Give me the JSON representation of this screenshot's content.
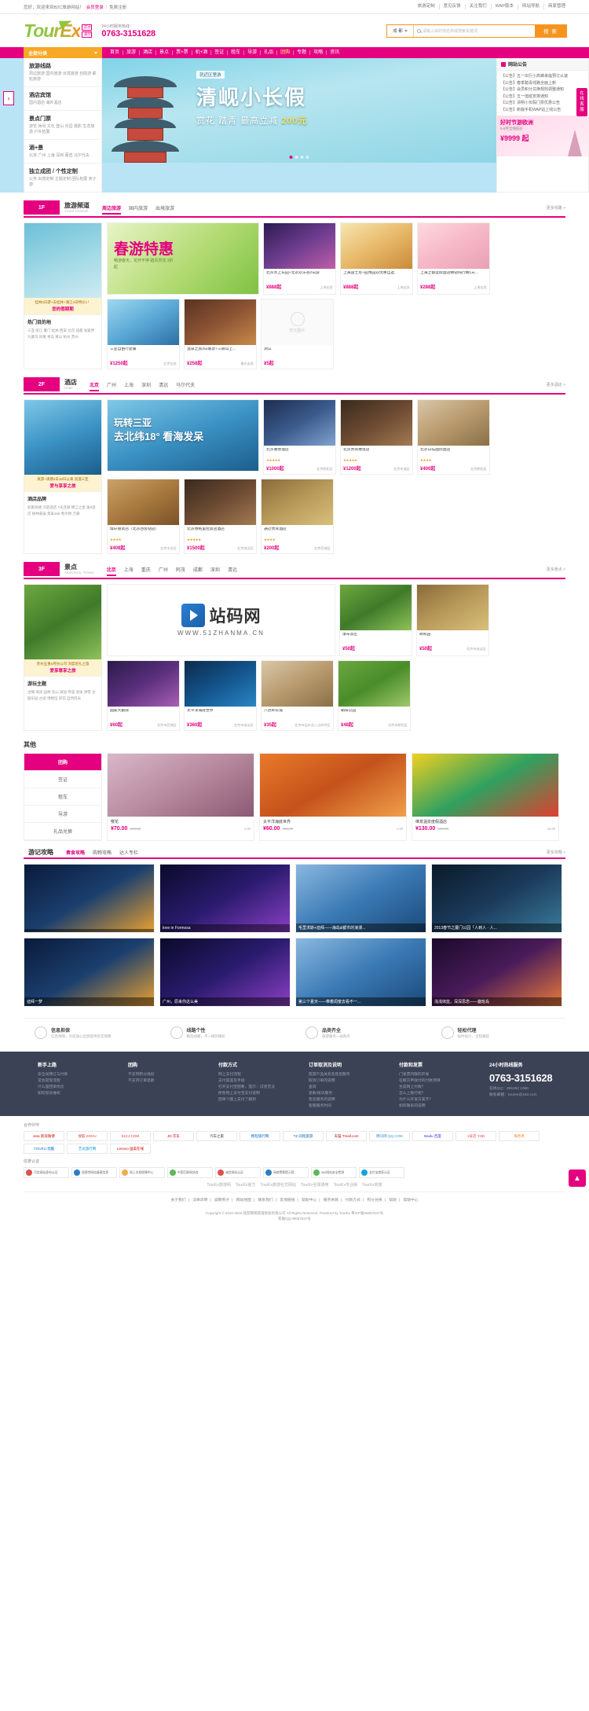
{
  "topbar": {
    "greeting": "您好，欢迎来到B2C旅游网站！",
    "login": "会员登录",
    "register": "免费注册",
    "right_links": [
      "旅游定制",
      "意见反馈",
      "关注我们",
      "WAP版本",
      "网站导航",
      "商家管理"
    ]
  },
  "header": {
    "logo_text": "TourEx",
    "badge1": "官方",
    "badge2": "演示",
    "phone_label": "24小时服务热线",
    "phone": "0763-3151628",
    "search": {
      "city": "成 都",
      "placeholder": "请输入目的地名称或搜索关键词",
      "button": "搜 索"
    }
  },
  "nav": {
    "category_label": "全部分类",
    "items": [
      {
        "label": "首页",
        "hot": false
      },
      {
        "label": "旅游",
        "hot": false
      },
      {
        "label": "酒店",
        "hot": false
      },
      {
        "label": "景点",
        "hot": false
      },
      {
        "label": "票+票",
        "hot": false
      },
      {
        "label": "机+酒",
        "hot": false
      },
      {
        "label": "签证",
        "hot": false
      },
      {
        "label": "租车",
        "hot": false
      },
      {
        "label": "导游",
        "hot": false
      },
      {
        "label": "礼品",
        "hot": false
      },
      {
        "label": "团购",
        "hot": true
      },
      {
        "label": "专题",
        "hot": false
      },
      {
        "label": "攻略",
        "hot": false
      },
      {
        "label": "资讯",
        "hot": false
      }
    ]
  },
  "categories": [
    {
      "title": "旅游线路",
      "sub": "周边旅游 国内旅游 出境旅游 自助游 邮轮旅游"
    },
    {
      "title": "酒店宾馆",
      "sub": "国内酒店 海外酒店"
    },
    {
      "title": "景点门票",
      "sub": "游览 休闲 文化 登山 乐园 摄影 生态旅游 户外拓展"
    },
    {
      "title": "酒+景",
      "sub": "北京 广州 上海 深圳 莆选 马尔代夫"
    },
    {
      "title": "独立成团 / 个性定制",
      "sub": "公务 出境定制 主题定制 团队拓展 亲子游"
    }
  ],
  "hero": {
    "badge": "就近区里游",
    "title": "清岘小长假",
    "sub_pre": "赏花 踏青 最高立减",
    "sub_price": "200元",
    "dots": 4,
    "active_dot": 0,
    "side_kefu": "在线客服",
    "arrow": "›"
  },
  "announce": {
    "title": "网站公告",
    "items": [
      "【公告】五一出行小高峰来临预订从速",
      "【公告】春季踏青线路全面上新",
      "【公告】会员积分兑换规则调整通知",
      "【公告】五一值班安排通知",
      "【公告】清明小长假门票优惠公告",
      "【公告】新版手机WAP站上线公告"
    ],
    "promo_t1": "好时节游欧洲",
    "promo_t2": "5-6月全线低价",
    "promo_t3": "¥9999 起"
  },
  "floors": [
    {
      "num": "1F",
      "name": "旅游频道",
      "en": "Travel Channel",
      "tabs": [
        "周边旅游",
        "国内旅游",
        "出境旅游"
      ],
      "active_tab": 0,
      "more": "更多线路 >",
      "left": {
        "caption_top": "桂林4日游+去桂林+漓江4日特价1！",
        "caption_b": "您的假期期",
        "sect_title": "热门目的地",
        "sect_links": "三亚 丽江 厦门 桂林 西安 北京 成都 张家界 九寨沟 凤凰 青岛 黄山 杭州 苏州"
      },
      "cards": [
        {
          "type": "big",
          "img": "im1",
          "title": "春游特惠",
          "sub": "畅游春天，花开不停 踏青赏花 3折起"
        },
        {
          "type": "card",
          "img": "im2",
          "title": "北京水上乐园+北京欢乐谷2日游",
          "price": "¥888起",
          "loc": "上海出发"
        },
        {
          "type": "card",
          "img": "im3",
          "title": "上海迪士尼+园博园双优惠自选",
          "price": "¥888起",
          "loc": "上海出发"
        },
        {
          "type": "card",
          "img": "im4",
          "title": "上海之都度假酒店精钻纯行精1天...",
          "price": "¥288起",
          "loc": "上海出发"
        },
        {
          "type": "card",
          "img": "im5",
          "title": "三亚自由行套餐",
          "price": "¥1250起",
          "loc": "北京出发"
        },
        {
          "type": "card",
          "img": "im6",
          "title": "温泉之旅3日联票+三峡山上...",
          "price": "¥258起",
          "loc": "重庆出发"
        },
        {
          "type": "noimg",
          "title": "测试",
          "price": "¥5起",
          "loc": "",
          "empty_label": "暂无图片"
        }
      ]
    },
    {
      "num": "2F",
      "name": "酒店",
      "en": "Hotel",
      "tabs": [
        "北京",
        "广州",
        "上海",
        "深圳",
        "清远",
        "马尔代夫"
      ],
      "active_tab": 0,
      "more": "更多酒店 >",
      "left": {
        "caption_top": "爽游~请期3日18日以来 浪漫三亚",
        "caption_b": "爱与享享之旅",
        "sect_title": "酒店品牌",
        "sect_links": "如家快捷 汉庭酒店 7天连锁 锦江之星 速8酒店 格林豪泰 莫泰168 希尔顿 万豪"
      },
      "cards": [
        {
          "type": "big",
          "img": "im11",
          "title": "玩转三亚",
          "sub": "去北纬18° 看海发呆"
        },
        {
          "type": "card",
          "img": "im10",
          "title": "北京君悦酒店",
          "stars": "★★★★★",
          "price": "¥1000起",
          "loc": "北京朝阳区"
        },
        {
          "type": "card",
          "img": "im8",
          "title": "北京贵宾楼饭店",
          "stars": "★★★★★",
          "price": "¥1200起",
          "loc": "北京东城区"
        },
        {
          "type": "card",
          "img": "im9",
          "title": "北京日坛国际酒店",
          "stars": "★★★★",
          "price": "¥400起",
          "loc": "北京朝阳区"
        },
        {
          "type": "card",
          "img": "im12",
          "title": "璨轩丽景店（北京西客站店）",
          "stars": "★★★★",
          "price": "¥408起",
          "loc": "北京丰台区"
        },
        {
          "type": "card",
          "img": "im8",
          "title": "北京香格里拉饭店酒店",
          "stars": "★★★★★",
          "price": "¥1500起",
          "loc": "北京海淀区"
        },
        {
          "type": "card",
          "img": "im16",
          "title": "通过贵宾酒店",
          "stars": "★★★★",
          "price": "¥200起",
          "loc": "北京西城区"
        }
      ]
    },
    {
      "num": "3F",
      "name": "景点",
      "en": "Attractions, Tickets",
      "tabs": [
        "北京",
        "上海",
        "重庆",
        "广州",
        "阿茂",
        "成都",
        "深圳",
        "清远"
      ],
      "active_tab": 0,
      "more": "更多景点 >",
      "left": {
        "caption_top": "贵州五重5月份公司 深度巡礼之旅",
        "caption_b": "爱享尊享之旅",
        "sect_title": "游玩主题",
        "sect_links": "古镇 海滨 园林 名山 湖泊 寺庙 温泉 滑雪 主题乐园 古迹 博物馆 赏花 自然风光"
      },
      "cards": [
        {
          "type": "watermark",
          "wm_text": "站码网",
          "wm_url": "WWW.51ZHANMA.CN"
        },
        {
          "type": "card",
          "img": "im13",
          "title": "瀑布景区",
          "price": "¥50起",
          "loc": ""
        },
        {
          "type": "card",
          "img": "im16",
          "title": "颐和园",
          "price": "¥50起",
          "loc": "北京市海淀区"
        },
        {
          "type": "card",
          "img": "im14",
          "title": "国家大剧院",
          "price": "¥60起",
          "loc": "北京市西城区"
        },
        {
          "type": "card",
          "img": "im15",
          "title": "太平洋海底世界",
          "price": "¥360起",
          "loc": "北京市海淀区"
        },
        {
          "type": "card",
          "img": "im9",
          "title": "八达岭长城",
          "price": "¥35起",
          "loc": "北京市延庆县八达岭特区"
        },
        {
          "type": "card",
          "img": "im17",
          "title": "朝阳公园",
          "price": "¥48起",
          "loc": "北京市朝阳区"
        }
      ]
    }
  ],
  "other": {
    "title": "其他",
    "tabs": [
      "团购",
      "签证",
      "租车",
      "导游",
      "礼品兑换"
    ],
    "active_tab": 0,
    "cards": [
      {
        "img": "im18",
        "title": "樱花",
        "price": "¥70.00",
        "old": "100.00",
        "sold": "1.00"
      },
      {
        "img": "im19",
        "title": "太平洋海底世界",
        "price": "¥60.00",
        "old": "405.00",
        "sold": "1.00"
      },
      {
        "img": "im20",
        "title": "维景温泉度假酒店",
        "price": "¥130.00",
        "old": "198.00",
        "sold": "44.00"
      }
    ]
  },
  "guides": {
    "title": "游记攻略",
    "tabs": [
      "奏食攻略",
      "购物攻略",
      "达人专栏"
    ],
    "active_tab": 0,
    "more": "更多攻略 >",
    "cards": [
      {
        "img": "im21",
        "caption": ""
      },
      {
        "img": "im22",
        "caption": "love in Formosa"
      },
      {
        "img": "im23",
        "caption": "毛里求斯+迪拜——海岛&都市的浪漫..."
      },
      {
        "img": "im24",
        "caption": "2013春节之厦门公园「人到人 · 人..."
      },
      {
        "img": "im21",
        "caption": "迪拜一梦"
      },
      {
        "img": "im22",
        "caption": "广州，原来你这么美"
      },
      {
        "img": "im23",
        "caption": "第三个夏天——带着闺蜜去看不一..."
      },
      {
        "img": "im25",
        "caption": "浅浅妹蓝，深深思念——塞班岛"
      }
    ]
  },
  "services": [
    {
      "icon": "shield-icon",
      "title": "信息担保",
      "sub": "信息保障，为您放心出游提供坚实保障"
    },
    {
      "icon": "route-icon",
      "title": "线路个性",
      "sub": "精选线路，不一样的精彩"
    },
    {
      "icon": "list-icon",
      "title": "品类齐全",
      "sub": "旅游服务一站购齐"
    },
    {
      "icon": "lock-icon",
      "title": "轻松代理",
      "sub": "省时省力，全程跟踪"
    }
  ],
  "footer": {
    "columns": [
      {
        "title": "新手上路",
        "lines": [
          "安全省预订与付款",
          "常会提现流程",
          "什么是团单优化",
          "如何投诉维权"
        ]
      },
      {
        "title": "团购",
        "lines": [
          "不支持积分抵扣",
          "不支持订单退款"
        ]
      },
      {
        "title": "付款方式",
        "lines": [
          "网上支付流程",
          "支付渠道及手续",
          "打开支付宝图要，提示：试货无法",
          "所售购上支付宝支付说明",
          "团单个图上支付了解到"
        ]
      },
      {
        "title": "订单取消及说明",
        "lines": [
          "旅游产品关系及售后服务",
          "取消订单的说明",
          "查询",
          "退款/投诉服务",
          "售后服务的说明",
          "客服服务时间"
        ]
      },
      {
        "title": "付款和发票",
        "lines": [
          "门发票内联的开发",
          "在哪方申收付的付款项目",
          "生成网上付款？",
          "怎么上报行呢？",
          "为什么开发方案不？",
          "如何联系的说明"
        ]
      }
    ],
    "contact": {
      "title": "24小时热线服务",
      "phone": "0763-3151628",
      "qq_label": "在线QQ：",
      "qq": "285182 1090",
      "email_label": "联系邮箱：",
      "email": "tourex@163.com"
    },
    "partner_label": "合作伙伴",
    "partners": [
      "sina 新浪微博",
      "搜狐 SOHU",
      "51CJ.COM",
      "JD 京东",
      "汽车之家",
      "携程旅行网",
      "TZ 同程旅游",
      "天猫 Tmall.com",
      "腾讯网 QQ.COM",
      "Baidu 百度",
      "1号店 YHD",
      "淘点点",
      "YOUKU 优酷",
      "艺龙旅行网",
      "Lenovo 国美在线"
    ],
    "cert_label": "信誉认证",
    "certs": [
      "可信网站身份认证",
      "经营性网站备案信息",
      "网上交易保障中心",
      "中国互联网协会",
      "诚信网站认证",
      "网络警察提示您",
      "360网站安全检测",
      "支付宝商家认证"
    ],
    "brandline": [
      "TourEx旅游网",
      "TourEx官方",
      "TourEx旅游社交网站",
      "TourEx全球通用",
      "TourEx专业版",
      "TourEx商旅"
    ],
    "links": [
      "关于我们",
      "法律声明",
      "诚聘英才",
      "网站地图",
      "联系我们",
      "友情链接",
      "帮助中心",
      "服务条款",
      "付款方式",
      "积分兑换",
      "帮助",
      "帮助中心"
    ],
    "copyright_line1": "Copyright © 2010-2016 旅游网络管理系统有限公司 All Rights Reserved. Powered by TourEx 粤ICP备05057647号",
    "copyright_line2": "客服QQ:09057647号"
  }
}
